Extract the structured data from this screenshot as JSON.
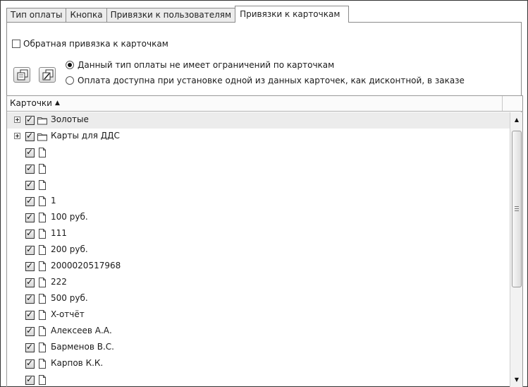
{
  "tabs": [
    {
      "label": "Тип оплаты",
      "active": false
    },
    {
      "label": "Кнопка",
      "active": false
    },
    {
      "label": "Привязки к пользователям",
      "active": false
    },
    {
      "label": "Привязки к карточкам",
      "active": true
    }
  ],
  "options": {
    "reverse_binding_label": "Обратная привязка к карточкам",
    "reverse_binding_checked": false,
    "radio_no_restrictions": "Данный тип оплаты не имеет ограничений по карточкам",
    "radio_card_required": "Оплата доступна при установке одной из данных карточек, как дисконтной, в заказе",
    "selected_radio": "radio_no_restrictions"
  },
  "toolbar_icons": [
    "copy-icon",
    "edit-copy-icon"
  ],
  "list": {
    "column_header": "Карточки",
    "sort_indicator": "▲",
    "items": [
      {
        "label": "Золотые",
        "type": "folder",
        "checked": true,
        "expandable": true,
        "selected": true
      },
      {
        "label": "Карты для ДДС",
        "type": "folder",
        "checked": true,
        "expandable": true,
        "selected": false
      },
      {
        "label": "",
        "type": "file",
        "checked": true
      },
      {
        "label": "",
        "type": "file",
        "checked": true
      },
      {
        "label": "",
        "type": "file",
        "checked": true
      },
      {
        "label": "1",
        "type": "file",
        "checked": true
      },
      {
        "label": "100 руб.",
        "type": "file",
        "checked": true
      },
      {
        "label": "111",
        "type": "file",
        "checked": true
      },
      {
        "label": "200 руб.",
        "type": "file",
        "checked": true
      },
      {
        "label": "2000020517968",
        "type": "file",
        "checked": true
      },
      {
        "label": "222",
        "type": "file",
        "checked": true
      },
      {
        "label": "500 руб.",
        "type": "file",
        "checked": true
      },
      {
        "label": "X-отчёт",
        "type": "file",
        "checked": true
      },
      {
        "label": "Алексеев А.А.",
        "type": "file",
        "checked": true
      },
      {
        "label": "Барменов В.С.",
        "type": "file",
        "checked": true
      },
      {
        "label": "Карпов К.К.",
        "type": "file",
        "checked": true
      },
      {
        "label": "",
        "type": "file",
        "checked": true
      }
    ]
  },
  "scrollbar": {
    "up": "▲",
    "down": "▼"
  }
}
